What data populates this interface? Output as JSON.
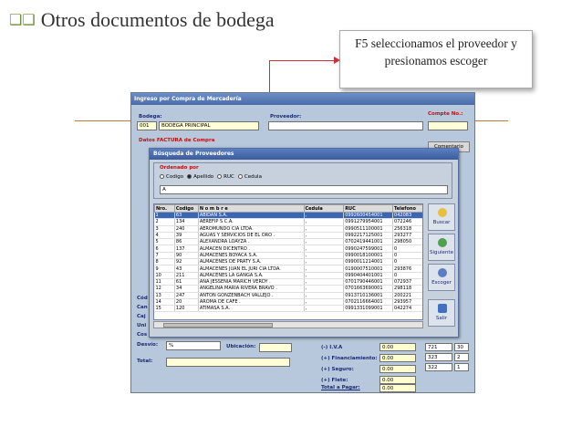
{
  "slide": {
    "title": "Otros documentos de bodega",
    "callout": "F5 seleccionamos el proveedor  y presionamos escoger"
  },
  "window": {
    "title": "Ingreso por Compra de Mercadería",
    "bodega_label": "Bodega:",
    "bodega_code": "001",
    "bodega_name": "BODEGA PRINCIPAL",
    "proveedor_label": "Proveedor:",
    "compte_label": "Compte No.:",
    "factura_label": "Datos FACTURA de Compra",
    "comentario_btn": "Comentario",
    "desvio_label": "Desvío:",
    "desvio_value": "%",
    "ubicacion_label": "Ubicación:",
    "total_label": "Total:",
    "left_labels": [
      "Cód",
      "Can",
      "Caj",
      "Uni",
      "Cos"
    ],
    "totals": [
      {
        "label": "(-) I.V.A",
        "value": "0.00"
      },
      {
        "label": "(+) Financiamiento:",
        "value": "0.00"
      },
      {
        "label": "(+) Seguro:",
        "value": "0.00"
      },
      {
        "label": "(+) Flete:",
        "value": "0.00"
      },
      {
        "label": "Total a Pagar:",
        "value": "0.00"
      }
    ],
    "right_nums": [
      "721",
      "30",
      "323",
      "2",
      "322",
      "1"
    ]
  },
  "dialog": {
    "title": "Búsqueda de Proveedores",
    "order_label": "Ordenado por",
    "options": [
      "Codigo",
      "Apellido",
      "RUC",
      "Cedula"
    ],
    "selected_option": "Apellido",
    "search_value": "A",
    "columns": [
      "Nro.",
      "Codigo",
      "N o m b r e",
      "Cedula",
      "RUC",
      "Telefono"
    ],
    "rows": [
      [
        "1",
        "63",
        "ABIDAN S.A.",
        ",",
        "0992600454001",
        "042083"
      ],
      [
        "2",
        "134",
        "AEREFIP S C.A.",
        ",",
        "0991279954001",
        "072246"
      ],
      [
        "3",
        "240",
        "AEROMUNDO CIA LTDA.",
        ",",
        "0990511100001",
        "256318"
      ],
      [
        "4",
        "39",
        "AGUAS Y SERVICIOS DE EL ORO .",
        ",",
        "0992217125001",
        "293277"
      ],
      [
        "5",
        "86",
        "ALEXANDRA LOAYZA .",
        ",",
        "0702419441001",
        "298050"
      ],
      [
        "6",
        "137",
        "ALMACEN DICENTRO .",
        ",",
        "0990247599001",
        "0"
      ],
      [
        "7",
        "90",
        "ALMACENES BOYACA S.A.",
        ",",
        "0990018100001",
        "0"
      ],
      [
        "8",
        "92",
        "ALMACENES DE PRATY S.A.",
        ",",
        "0990011214001",
        "0"
      ],
      [
        "9",
        "43",
        "ALMACENES JUAN EL JURI CIA LTDA.",
        ",",
        "0190007510001",
        "293876"
      ],
      [
        "10",
        "211",
        "ALMACENES LA GANGA S.A.",
        ",",
        "0990404401001",
        "0"
      ],
      [
        "11",
        "61",
        "ANA JESSENIA MARICH VERDY .",
        ",",
        "0701790446001",
        "072937"
      ],
      [
        "12",
        "34",
        "ANGELINA MARIA RIVERA BRAVO .",
        ",",
        "0701663690001",
        "298118"
      ],
      [
        "13",
        "247",
        "ANTON GONZENBACH VALLEJO .",
        ",",
        "0913710136001",
        "200221"
      ],
      [
        "14",
        "20",
        "AROMA DE CAFE .",
        ",",
        "0702116664001",
        "293957"
      ],
      [
        "15",
        "120",
        "ATIMASA S.A.",
        ",",
        "0991331099001",
        "042274"
      ]
    ],
    "buttons": [
      "Buscar",
      "Siguiente",
      "Escoger",
      "Salir"
    ]
  }
}
